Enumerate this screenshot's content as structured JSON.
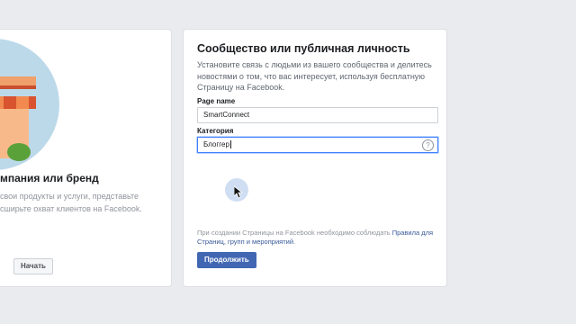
{
  "left_card": {
    "title": "мпания или бренд",
    "description": "свои продукты и услуги, представьте\nсширьте охват клиентов на Facebook.",
    "start_button": "Начать"
  },
  "right_card": {
    "title": "Сообщество или публичная личность",
    "description": "Установите связь с людьми из вашего сообщества и делитесь новостями о том, что вас интересует, используя бесплатную Страницу на Facebook.",
    "page_name_label": "Page name",
    "page_name_value": "SmartConnect",
    "category_label": "Категория",
    "category_value": "Блоггер",
    "help_icon": "?",
    "note_text": "При создании Страницы на Facebook необходимо соблюдать ",
    "note_link": "Правила для Страниц, групп и мероприятий",
    "note_end": ".",
    "continue_button": "Продолжить"
  },
  "colors": {
    "accent": "#4267b2",
    "link": "#385898",
    "background": "#e9ebee"
  }
}
